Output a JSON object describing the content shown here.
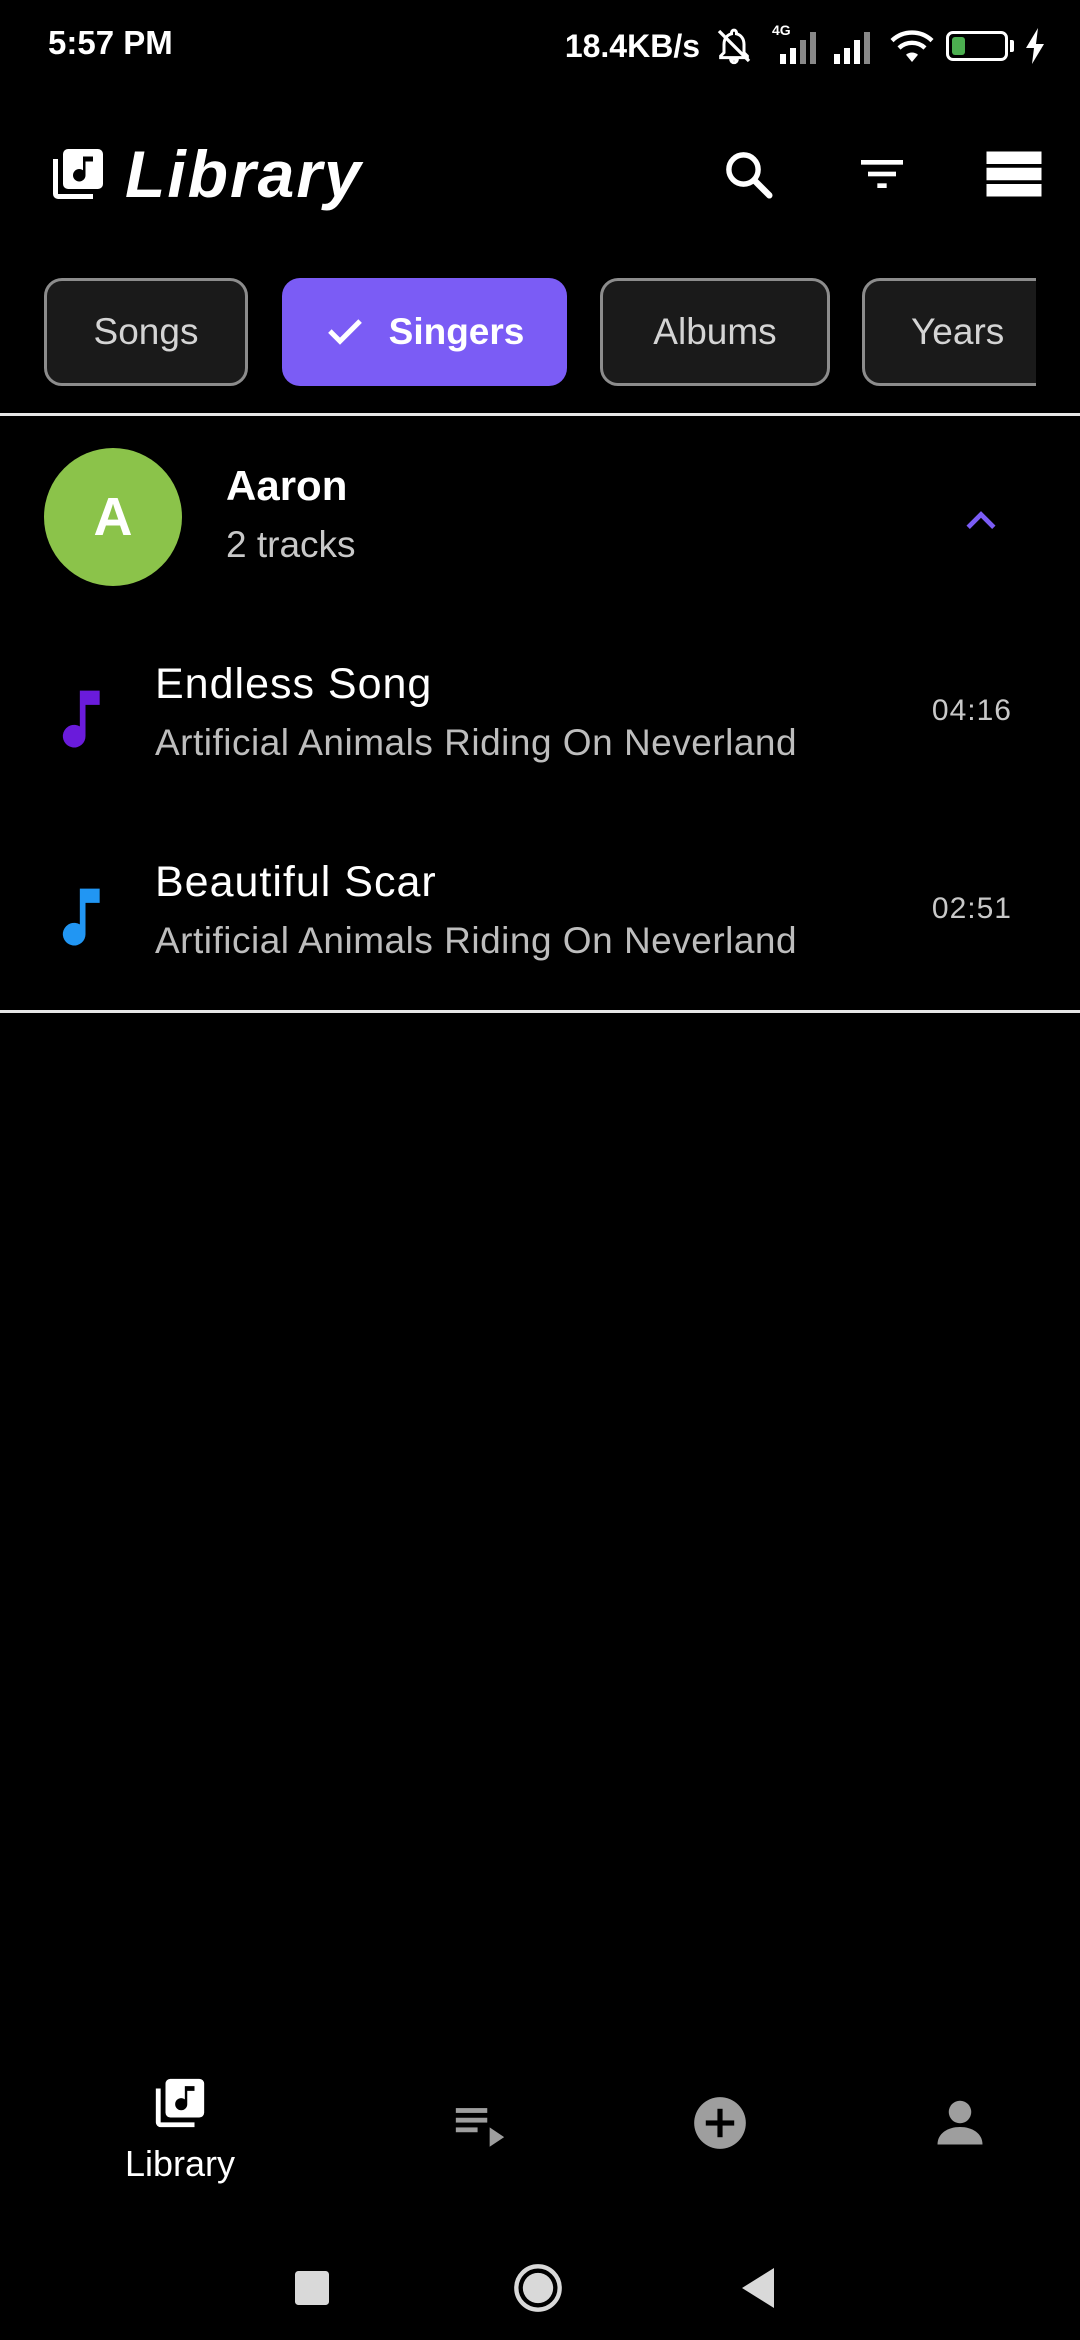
{
  "status_bar": {
    "time": "5:57 PM",
    "net_speed": "18.4KB/s",
    "network_type": "4G",
    "battery": "26",
    "icons": [
      "mute-bell-icon",
      "signal-4g-icon",
      "signal-icon",
      "wifi-icon",
      "battery-icon",
      "charging-icon"
    ]
  },
  "header": {
    "title": "Library",
    "icons": [
      "library-music-icon",
      "search-icon",
      "filter-icon",
      "view-list-icon"
    ]
  },
  "filters": {
    "chips": [
      {
        "label": "Songs",
        "selected": false
      },
      {
        "label": "Singers",
        "selected": true
      },
      {
        "label": "Albums",
        "selected": false
      },
      {
        "label": "Years",
        "selected": false
      }
    ]
  },
  "artist": {
    "initial": "A",
    "name": "Aaron",
    "count": "2 tracks",
    "avatar_color": "#8bc34a",
    "expanded": true
  },
  "tracks": [
    {
      "title": "Endless Song",
      "artist": "Artificial Animals Riding On Neverland",
      "duration": "04:16",
      "icon_color": "#6a1bdb"
    },
    {
      "title": "Beautiful Scar",
      "artist": "Artificial Animals Riding On Neverland",
      "duration": "02:51",
      "icon_color": "#2196f3"
    }
  ],
  "bottom_nav": {
    "library_label": "Library",
    "icons": [
      "library-music-icon",
      "queue-play-icon",
      "add-circle-icon",
      "person-icon"
    ]
  },
  "colors": {
    "accent": "#7b5cf5",
    "collapse_arrow": "#7b5cf5",
    "battery_fill": "#4caf50"
  }
}
